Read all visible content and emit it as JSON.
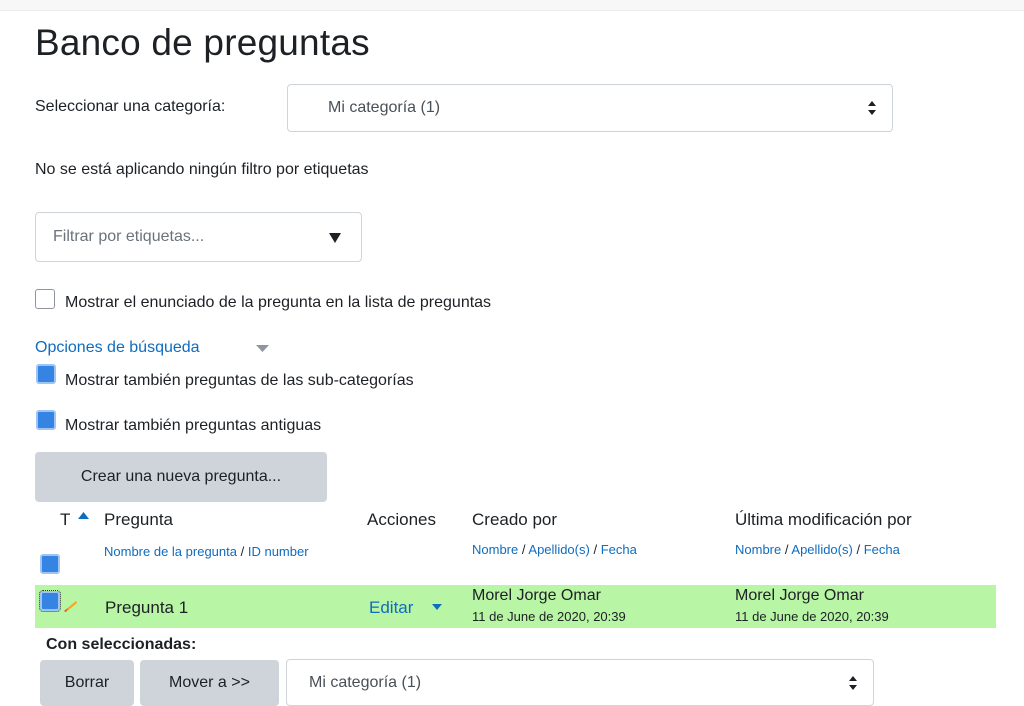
{
  "page_title": "Banco de preguntas",
  "category_select": {
    "label": "Seleccionar una categoría:",
    "value": "Mi categoría (1)"
  },
  "tag_filter_status": "No se está aplicando ningún filtro por etiquetas",
  "tag_filter_input": {
    "placeholder": "Filtrar por etiquetas..."
  },
  "show_question_text": {
    "label": "Mostrar el enunciado de la pregunta en la lista de preguntas",
    "checked": false
  },
  "search_options": {
    "label": "Opciones de búsqueda",
    "show_subcategories": {
      "label": "Mostrar también preguntas de las sub-categorías",
      "checked": true
    },
    "show_old": {
      "label": "Mostrar también preguntas antiguas",
      "checked": true
    }
  },
  "create_button": "Crear una nueva pregunta...",
  "table": {
    "headers": {
      "type": "T",
      "question": "Pregunta",
      "question_sub_name": "Nombre de la pregunta",
      "question_sub_sep": "/",
      "question_sub_id": "ID number",
      "actions": "Acciones",
      "created_by": "Creado por",
      "last_modified_by": "Última modificación por",
      "sub_name": "Nombre",
      "sub_surname": "Apellido(s)",
      "sub_date": "Fecha",
      "sub_sep": "/"
    },
    "rows": [
      {
        "question": "Pregunta 1",
        "action": "Editar",
        "created_by": "Morel Jorge Omar",
        "created_date": "11 de June de 2020, 20:39",
        "modified_by": "Morel Jorge Omar",
        "modified_date": "11 de June de 2020, 20:39"
      }
    ]
  },
  "with_selected": {
    "label": "Con seleccionadas:",
    "delete_button": "Borrar",
    "move_button": "Mover a >>",
    "category_value": "Mi categoría (1)"
  },
  "colors": {
    "link": "#0f6cbf",
    "row_highlight": "#b8f5a4",
    "button": "#ced4da",
    "checkbox": "#3584e4"
  }
}
